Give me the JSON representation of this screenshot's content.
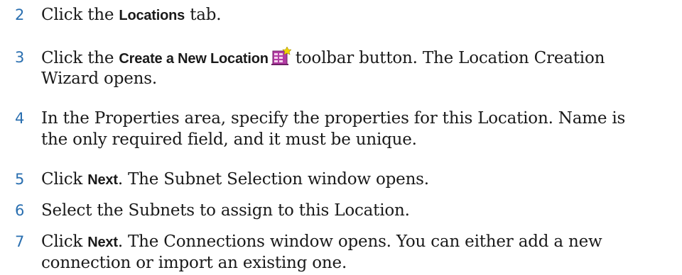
{
  "steps": [
    {
      "number": "2",
      "pre": "Click the ",
      "ui": "Locations",
      "post": " tab."
    },
    {
      "number": "3",
      "pre": "Click the ",
      "ui": "Create a New Location",
      "post_icon": "toolbar button. The Location Creation",
      "line2": "Wizard opens.",
      "icon": "create-location-icon"
    },
    {
      "number": "4",
      "line1": "In the Properties area, specify the properties for this Location. Name is",
      "line2": "the only required field, and it must be unique."
    },
    {
      "number": "5",
      "pre": "Click ",
      "ui": "Next",
      "post": ". The Subnet Selection window opens."
    },
    {
      "number": "6",
      "line1": "Select the Subnets to assign to this Location."
    },
    {
      "number": "7",
      "pre": "Click ",
      "ui": "Next",
      "post": ". The Connections window opens. You can either add a new",
      "line2": "connection or import an existing one."
    }
  ],
  "colors": {
    "step_number": "#2a6fb0",
    "text": "#1a1a1a"
  }
}
